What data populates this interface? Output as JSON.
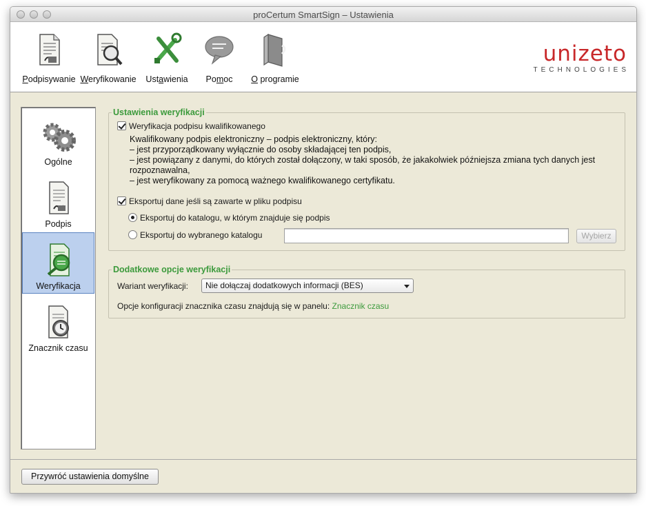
{
  "window": {
    "title": "proCertum SmartSign – Ustawienia"
  },
  "toolbar": {
    "items": [
      {
        "label": "Podpisywanie",
        "mnemonic": "P",
        "rest": "odpisywanie",
        "icon": "document-sign-icon"
      },
      {
        "label": "Weryfikowanie",
        "mnemonic": "W",
        "rest": "eryfikowanie",
        "icon": "document-magnifier-icon"
      },
      {
        "label": "Ustawienia",
        "pre": "Ust",
        "mnemonic": "a",
        "rest": "wienia",
        "icon": "tools-icon"
      },
      {
        "label": "Pomoc",
        "pre": "Po",
        "mnemonic": "m",
        "rest": "oc",
        "icon": "speech-bubble-icon"
      },
      {
        "label": "O programie",
        "mnemonic": "O",
        "rest": " programie",
        "icon": "info-document-icon"
      }
    ]
  },
  "logo": {
    "word": "unizeto",
    "sub": "TECHNOLOGIES"
  },
  "sidebar": {
    "items": [
      {
        "label": "Ogólne",
        "icon": "gears-icon",
        "selected": false
      },
      {
        "label": "Podpis",
        "icon": "signature-document-icon",
        "selected": false
      },
      {
        "label": "Weryfikacja",
        "icon": "verification-icon",
        "selected": true
      },
      {
        "label": "Znacznik czasu",
        "icon": "clock-document-icon",
        "selected": false
      }
    ]
  },
  "verification": {
    "legend": "Ustawienia weryfikacji",
    "qualified_checkbox": {
      "label": "Weryfikacja podpisu kwalifikowanego",
      "checked": true
    },
    "description": [
      "Kwalifikowany podpis elektroniczny – podpis elektroniczny, który:",
      "– jest przyporządkowany wyłącznie do osoby składającej ten podpis,",
      "– jest powiązany z danymi, do których został dołączony, w taki sposób, że jakakolwiek późniejsza zmiana tych danych jest rozpoznawalna,",
      "– jest weryfikowany za pomocą ważnego kwalifikowanego certyfikatu."
    ],
    "export_checkbox": {
      "label": "Eksportuj dane jeśli są zawarte w pliku podpisu",
      "checked": true
    },
    "radio_same": {
      "label": "Eksportuj do katalogu, w którym znajduje się podpis",
      "checked": true
    },
    "radio_choose": {
      "label": "Eksportuj do wybranego katalogu",
      "checked": false
    },
    "directory_value": "",
    "choose_button": "Wybierz"
  },
  "additional": {
    "legend": "Dodatkowe opcje weryfikacji",
    "variant_label": "Wariant weryfikacji:",
    "variant_value": "Nie dołączaj dodatkowych informacji (BES)",
    "timestamp_text": "Opcje konfiguracji znacznika czasu znajdują się w panelu:",
    "timestamp_link": "Znacznik czasu"
  },
  "footer": {
    "restore_button": "Przywróć ustawienia domyślne"
  },
  "colors": {
    "accent_green": "#3c9a3c",
    "logo_red": "#c8282a",
    "selection": "#bcd0ee"
  }
}
